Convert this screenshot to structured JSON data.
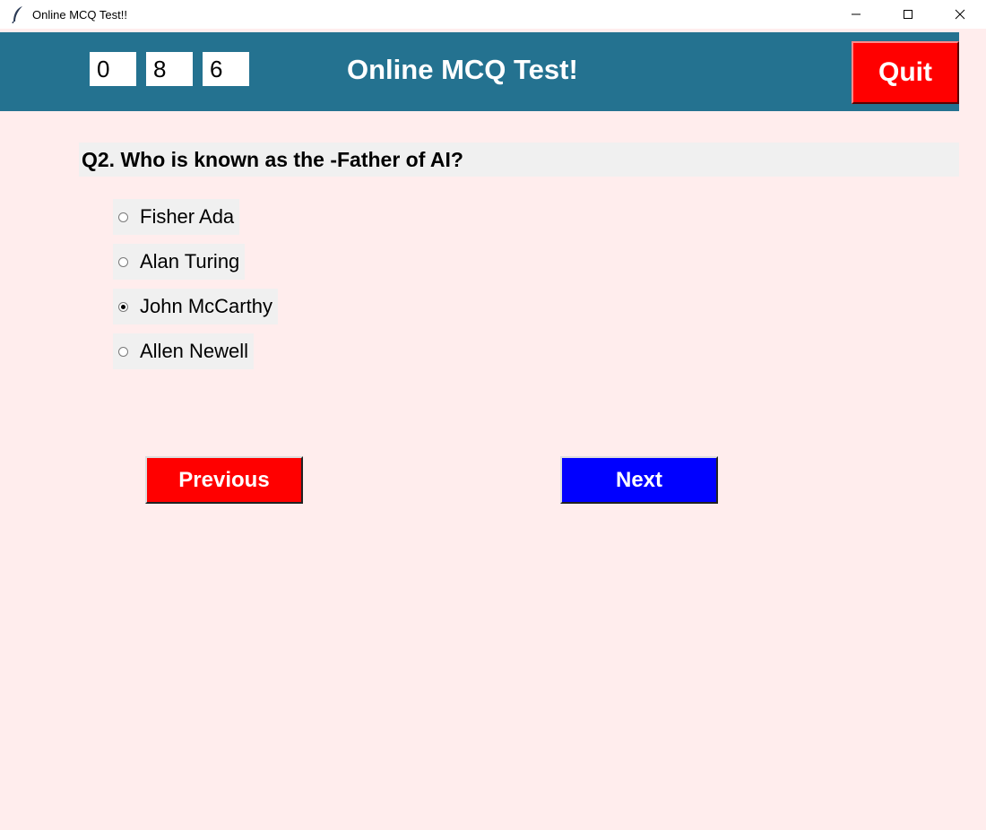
{
  "window": {
    "title": "Online MCQ Test!!",
    "app_icon": "feather-icon",
    "controls": [
      "minimize-icon",
      "maximize-icon",
      "close-icon"
    ]
  },
  "header": {
    "title": "Online MCQ Test!",
    "timer": [
      "0",
      "8",
      "6"
    ],
    "quit_label": "Quit",
    "background": "#247290",
    "quit_color": "#ff0000"
  },
  "question": {
    "text": "Q2. Who is known as the -Father of AI?",
    "options": [
      {
        "label": "Fisher Ada",
        "selected": false
      },
      {
        "label": "Alan Turing",
        "selected": false
      },
      {
        "label": "John McCarthy",
        "selected": true
      },
      {
        "label": "Allen Newell",
        "selected": false
      }
    ]
  },
  "navigation": {
    "previous_label": "Previous",
    "next_label": "Next",
    "previous_color": "#ff0000",
    "next_color": "#0000ff"
  },
  "colors": {
    "page_background": "#ffeded",
    "question_background": "#f0f0f0"
  }
}
